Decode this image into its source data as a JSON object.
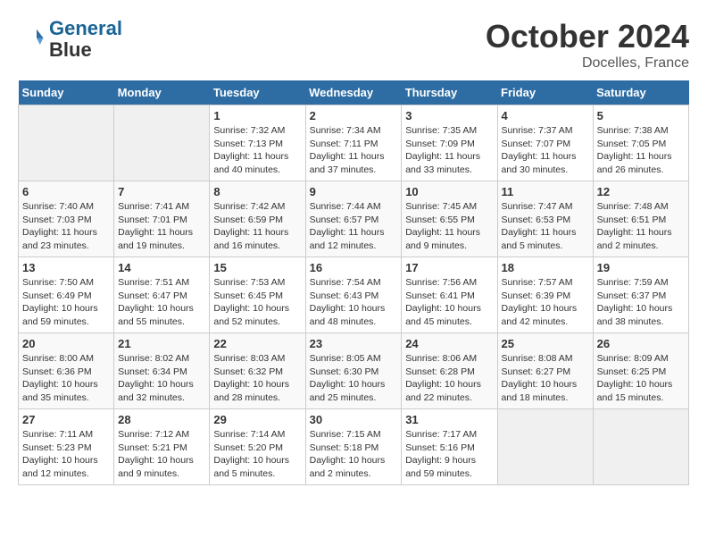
{
  "header": {
    "logo_line1": "General",
    "logo_line2": "Blue",
    "month": "October 2024",
    "location": "Docelles, France"
  },
  "days_of_week": [
    "Sunday",
    "Monday",
    "Tuesday",
    "Wednesday",
    "Thursday",
    "Friday",
    "Saturday"
  ],
  "weeks": [
    [
      {
        "day": "",
        "sunrise": "",
        "sunset": "",
        "daylight": ""
      },
      {
        "day": "",
        "sunrise": "",
        "sunset": "",
        "daylight": ""
      },
      {
        "day": "1",
        "sunrise": "Sunrise: 7:32 AM",
        "sunset": "Sunset: 7:13 PM",
        "daylight": "Daylight: 11 hours and 40 minutes."
      },
      {
        "day": "2",
        "sunrise": "Sunrise: 7:34 AM",
        "sunset": "Sunset: 7:11 PM",
        "daylight": "Daylight: 11 hours and 37 minutes."
      },
      {
        "day": "3",
        "sunrise": "Sunrise: 7:35 AM",
        "sunset": "Sunset: 7:09 PM",
        "daylight": "Daylight: 11 hours and 33 minutes."
      },
      {
        "day": "4",
        "sunrise": "Sunrise: 7:37 AM",
        "sunset": "Sunset: 7:07 PM",
        "daylight": "Daylight: 11 hours and 30 minutes."
      },
      {
        "day": "5",
        "sunrise": "Sunrise: 7:38 AM",
        "sunset": "Sunset: 7:05 PM",
        "daylight": "Daylight: 11 hours and 26 minutes."
      }
    ],
    [
      {
        "day": "6",
        "sunrise": "Sunrise: 7:40 AM",
        "sunset": "Sunset: 7:03 PM",
        "daylight": "Daylight: 11 hours and 23 minutes."
      },
      {
        "day": "7",
        "sunrise": "Sunrise: 7:41 AM",
        "sunset": "Sunset: 7:01 PM",
        "daylight": "Daylight: 11 hours and 19 minutes."
      },
      {
        "day": "8",
        "sunrise": "Sunrise: 7:42 AM",
        "sunset": "Sunset: 6:59 PM",
        "daylight": "Daylight: 11 hours and 16 minutes."
      },
      {
        "day": "9",
        "sunrise": "Sunrise: 7:44 AM",
        "sunset": "Sunset: 6:57 PM",
        "daylight": "Daylight: 11 hours and 12 minutes."
      },
      {
        "day": "10",
        "sunrise": "Sunrise: 7:45 AM",
        "sunset": "Sunset: 6:55 PM",
        "daylight": "Daylight: 11 hours and 9 minutes."
      },
      {
        "day": "11",
        "sunrise": "Sunrise: 7:47 AM",
        "sunset": "Sunset: 6:53 PM",
        "daylight": "Daylight: 11 hours and 5 minutes."
      },
      {
        "day": "12",
        "sunrise": "Sunrise: 7:48 AM",
        "sunset": "Sunset: 6:51 PM",
        "daylight": "Daylight: 11 hours and 2 minutes."
      }
    ],
    [
      {
        "day": "13",
        "sunrise": "Sunrise: 7:50 AM",
        "sunset": "Sunset: 6:49 PM",
        "daylight": "Daylight: 10 hours and 59 minutes."
      },
      {
        "day": "14",
        "sunrise": "Sunrise: 7:51 AM",
        "sunset": "Sunset: 6:47 PM",
        "daylight": "Daylight: 10 hours and 55 minutes."
      },
      {
        "day": "15",
        "sunrise": "Sunrise: 7:53 AM",
        "sunset": "Sunset: 6:45 PM",
        "daylight": "Daylight: 10 hours and 52 minutes."
      },
      {
        "day": "16",
        "sunrise": "Sunrise: 7:54 AM",
        "sunset": "Sunset: 6:43 PM",
        "daylight": "Daylight: 10 hours and 48 minutes."
      },
      {
        "day": "17",
        "sunrise": "Sunrise: 7:56 AM",
        "sunset": "Sunset: 6:41 PM",
        "daylight": "Daylight: 10 hours and 45 minutes."
      },
      {
        "day": "18",
        "sunrise": "Sunrise: 7:57 AM",
        "sunset": "Sunset: 6:39 PM",
        "daylight": "Daylight: 10 hours and 42 minutes."
      },
      {
        "day": "19",
        "sunrise": "Sunrise: 7:59 AM",
        "sunset": "Sunset: 6:37 PM",
        "daylight": "Daylight: 10 hours and 38 minutes."
      }
    ],
    [
      {
        "day": "20",
        "sunrise": "Sunrise: 8:00 AM",
        "sunset": "Sunset: 6:36 PM",
        "daylight": "Daylight: 10 hours and 35 minutes."
      },
      {
        "day": "21",
        "sunrise": "Sunrise: 8:02 AM",
        "sunset": "Sunset: 6:34 PM",
        "daylight": "Daylight: 10 hours and 32 minutes."
      },
      {
        "day": "22",
        "sunrise": "Sunrise: 8:03 AM",
        "sunset": "Sunset: 6:32 PM",
        "daylight": "Daylight: 10 hours and 28 minutes."
      },
      {
        "day": "23",
        "sunrise": "Sunrise: 8:05 AM",
        "sunset": "Sunset: 6:30 PM",
        "daylight": "Daylight: 10 hours and 25 minutes."
      },
      {
        "day": "24",
        "sunrise": "Sunrise: 8:06 AM",
        "sunset": "Sunset: 6:28 PM",
        "daylight": "Daylight: 10 hours and 22 minutes."
      },
      {
        "day": "25",
        "sunrise": "Sunrise: 8:08 AM",
        "sunset": "Sunset: 6:27 PM",
        "daylight": "Daylight: 10 hours and 18 minutes."
      },
      {
        "day": "26",
        "sunrise": "Sunrise: 8:09 AM",
        "sunset": "Sunset: 6:25 PM",
        "daylight": "Daylight: 10 hours and 15 minutes."
      }
    ],
    [
      {
        "day": "27",
        "sunrise": "Sunrise: 7:11 AM",
        "sunset": "Sunset: 5:23 PM",
        "daylight": "Daylight: 10 hours and 12 minutes."
      },
      {
        "day": "28",
        "sunrise": "Sunrise: 7:12 AM",
        "sunset": "Sunset: 5:21 PM",
        "daylight": "Daylight: 10 hours and 9 minutes."
      },
      {
        "day": "29",
        "sunrise": "Sunrise: 7:14 AM",
        "sunset": "Sunset: 5:20 PM",
        "daylight": "Daylight: 10 hours and 5 minutes."
      },
      {
        "day": "30",
        "sunrise": "Sunrise: 7:15 AM",
        "sunset": "Sunset: 5:18 PM",
        "daylight": "Daylight: 10 hours and 2 minutes."
      },
      {
        "day": "31",
        "sunrise": "Sunrise: 7:17 AM",
        "sunset": "Sunset: 5:16 PM",
        "daylight": "Daylight: 9 hours and 59 minutes."
      },
      {
        "day": "",
        "sunrise": "",
        "sunset": "",
        "daylight": ""
      },
      {
        "day": "",
        "sunrise": "",
        "sunset": "",
        "daylight": ""
      }
    ]
  ]
}
